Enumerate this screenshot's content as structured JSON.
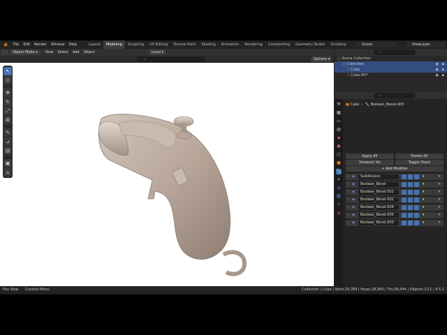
{
  "menu": [
    "File",
    "Edit",
    "Render",
    "Window",
    "Help"
  ],
  "workspaces": [
    "Layout",
    "Modeling",
    "Sculpting",
    "UV Editing",
    "Texture Paint",
    "Shading",
    "Animation",
    "Rendering",
    "Compositing",
    "Geometry Nodes",
    "Scripting"
  ],
  "active_workspace": "Modeling",
  "scene": "Scene",
  "view_layer": "ViewLayer",
  "header": {
    "mode": "Object Mode",
    "menus": [
      "View",
      "Select",
      "Add",
      "Object"
    ],
    "transform": "Local",
    "options": "Options"
  },
  "outliner": {
    "rows": [
      {
        "label": "Scene Collection",
        "selected": false,
        "indent": 0
      },
      {
        "label": "Collection",
        "selected": true,
        "indent": 1
      },
      {
        "label": "Cube",
        "selected": true,
        "indent": 2
      },
      {
        "label": "Cube.907",
        "selected": false,
        "indent": 2
      }
    ]
  },
  "properties": {
    "breadcrumb_object": "Cube",
    "breadcrumb_modifier": "Boolean_Bevel.003",
    "apply_all": "Apply All",
    "delete_all": "Delete All",
    "viewport_vis": "Viewport Vis",
    "toggle_stack": "Toggle Stack",
    "add_modifier": "Add Modifier",
    "modifiers": [
      "Subdivision",
      "Boolean_Bevel",
      "Boolean_Bevel.001",
      "Boolean_Bevel.002",
      "Boolean_Bevel.004",
      "Boolean_Bevel.005",
      "Boolean_Bevel.003"
    ]
  },
  "status": {
    "left": "Pan View",
    "left2": "Context Menu",
    "right": "Collection | Cube | Verts:29,289 | Faces:28,984 | Tris:58,544 | Objects:1/11 | 4.5.2"
  },
  "colors": {
    "accent": "#4772b3",
    "logo": "#e87d0d",
    "model": "#b8a79a"
  }
}
